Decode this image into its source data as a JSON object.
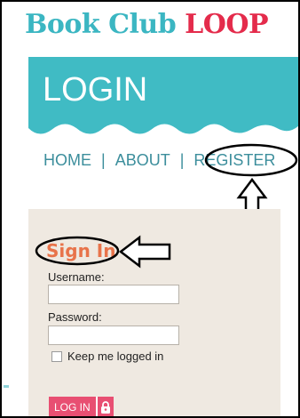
{
  "brand": {
    "part1": "Book Club",
    "part2": "LOOP"
  },
  "banner": {
    "title": "LOGIN"
  },
  "nav": {
    "home": "HOME",
    "about": "ABOUT",
    "separator": "|",
    "register": "REGISTER"
  },
  "signin": {
    "heading": "Sign In",
    "username_label": "Username:",
    "username_value": "",
    "password_label": "Password:",
    "password_value": "",
    "remember_label": "Keep me logged in",
    "remember_checked": false,
    "login_button": "LOG IN",
    "login_icon": "lock-icon"
  },
  "colors": {
    "brand_teal": "#3bb6c2",
    "brand_red": "#e42b4b",
    "banner_teal": "#40bbc4",
    "nav_text": "#3c8e9c",
    "panel_bg": "#efe9e1",
    "signin_orange": "#e8734a",
    "button_pink": "#e84f72"
  },
  "annotations": {
    "register_circle": "ellipse",
    "register_arrow": "arrow-up-icon",
    "signin_circle": "ellipse",
    "signin_arrow": "arrow-left-icon"
  }
}
